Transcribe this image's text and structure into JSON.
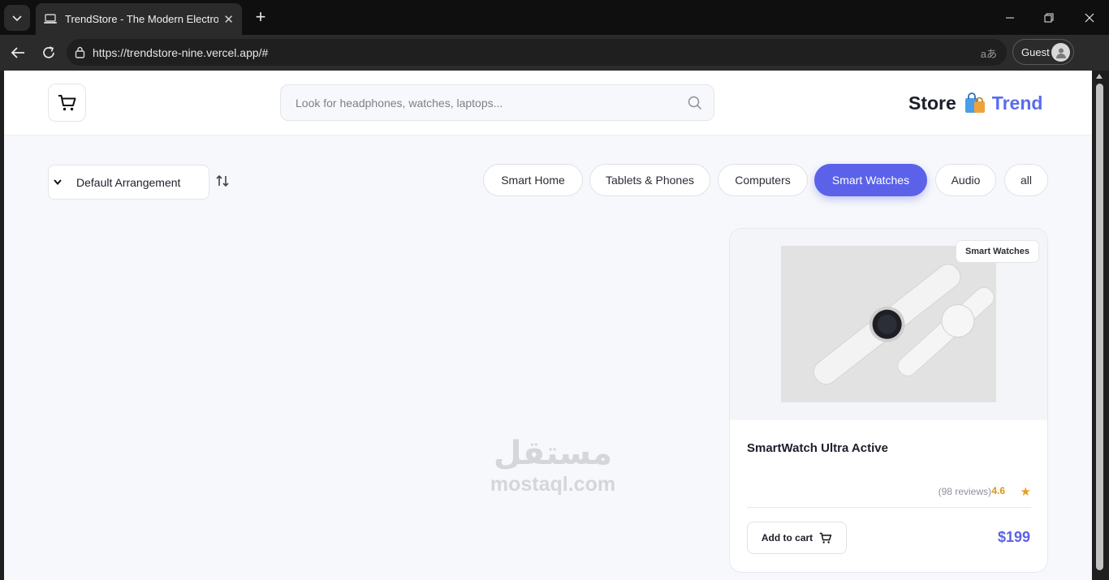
{
  "browser": {
    "tab_title": "TrendStore - The Modern Electronics",
    "url": "https://trendstore-nine.vercel.app/#",
    "profile_label": "Guest"
  },
  "header": {
    "search_placeholder": "Look for headphones, watches, laptops...",
    "logo_store": "Store",
    "logo_trend": "Trend"
  },
  "toolbar": {
    "sort_label": "Default Arrangement",
    "categories": [
      "Smart Home",
      "Tablets & Phones",
      "Computers",
      "Smart Watches",
      "Audio",
      "all"
    ],
    "active_category": "Smart Watches"
  },
  "product": {
    "badge": "Smart Watches",
    "name": "SmartWatch Ultra Active",
    "reviews": "(98 reviews)",
    "rating": "4.6",
    "add_to_cart": "Add to cart",
    "price": "$199"
  },
  "watermark": {
    "arabic": "مستقل",
    "latin": "mostaql.com"
  },
  "colors": {
    "accent": "#5b62e9",
    "logo_trend": "#5b6cf0",
    "rating": "#d8961a"
  }
}
